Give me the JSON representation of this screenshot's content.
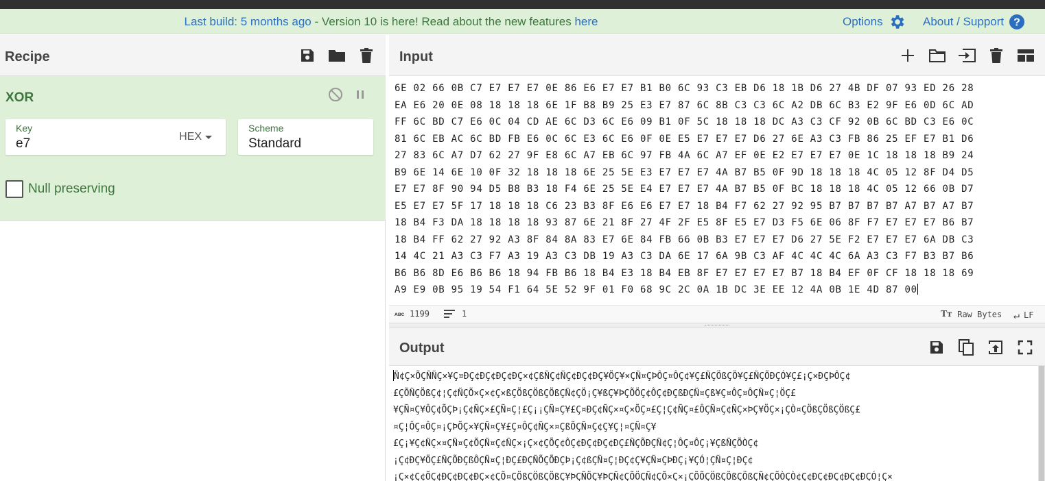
{
  "banner": {
    "last_build": "Last build: 5 months ago",
    "message": " - Version 10 is here! Read about the new features ",
    "link": "here",
    "options_label": "Options",
    "about_label": "About / Support"
  },
  "recipe": {
    "title": "Recipe",
    "operation": {
      "name": "XOR",
      "key_label": "Key",
      "key_value": "e7",
      "key_format": "HEX",
      "scheme_label": "Scheme",
      "scheme_value": "Standard",
      "null_preserving_label": "Null preserving"
    }
  },
  "input": {
    "title": "Input",
    "hex_lines": [
      "6E 02 66 0B C7 E7 E7 E7 0E 86 E6 E7 E7 B1 B0 6C 93 C3 EB D6 18 1B D6 27 4B DF 07 93 ED 26 28",
      "EA E6 20 0E 08 18 18 18 6E 1F B8 B9 25 E3 E7 87 6C 8B C3 C3 6C A2 DB 6C B3 E2 9F E6 0D 6C AD",
      "FF 6C BD C7 E6 0C 04 CD AE 6C D3 6C E6 09 B1 0F 5C 18 18 18 DC A3 C3 CF 92 0B 6C BD C3 E6 0C",
      "81 6C EB AC 6C BD FB E6 0C 6C E3 6C E6 0F 0E E5 E7 E7 E7 D6 27 6E A3 C3 FB 86 25 EF E7 B1 D6",
      "27 83 6C A7 D7 62 27 9F E8 6C A7 EB 6C 97 FB 4A 6C A7 EF 0E E2 E7 E7 E7 0E 1C 18 18 18 B9 24",
      "B9 6E 14 6E 10 0F 32 18 18 18 6E 25 5E E3 E7 E7 E7 4A B7 B5 0F 9D 18 18 18 4C 05 12 8F D4 D5",
      "E7 E7 8F 90 94 D5 B8 B3 18 F4 6E 25 5E E4 E7 E7 E7 4A B7 B5 0F BC 18 18 18 4C 05 12 66 0B D7",
      "E5 E7 E7 5F 17 18 18 18 C6 23 B3 8F E6 E6 E7 E7 18 B4 F7 62 27 92 95 B7 B7 B7 B7 A7 B7 A7 B7",
      "18 B4 F3 DA 18 18 18 18 93 87 6E 21 8F 27 4F 2F E5 8F E5 E7 D3 F5 6E 06 8F F7 E7 E7 E7 B6 B7",
      "18 B4 FF 62 27 92 A3 8F 84 8A 83 E7 6E 84 FB 66 0B B3 E7 E7 E7 D6 27 5E F2 E7 E7 E7 6A DB C3",
      "14 4C 21 A3 C3 F7 A3 19 A3 C3 DB 19 A3 C3 DA 6E 17 6A 9B C3 AF 4C 4C 4C 6A A3 C3 F7 B3 B7 B6",
      "B6 B6 8D E6 B6 B6 18 94 FB B6 18 B4 E3 18 B4 EB 8F E7 E7 E7 E7 B7 18 B4 EF 0F CF 18 18 18 69",
      "A9 E9 0B 95 19 54 F1 64 5E 52 9F 01 F0 68 9C 2C 0A 1B DC 3E EE 12 4A 0B 1E 4D 87 00"
    ],
    "length": "1199",
    "lines": "1",
    "encoding": "Raw Bytes",
    "eol": "LF"
  },
  "output": {
    "title": "Output",
    "lines": [
      "Ñ¢Ç×ÕÇÑÑÇ×¥Ç¤ÐÇ¢ÐÇ¢ÐÇ¢ÐÇ×¢ÇßÑÇ¢ÑÇ¢ÐÇ¢ÐÇ¥ÖÇ¥×ÇÑ¤ÇÞÔÇ¤ÔÇ¢¥Ç£ÑÇÖßÇÖ¥Ç£ÑÇÕÐÇÓ¥Ç£¡Ç×ÐÇÞÔÇ¢",
      "£ÇÕÑÇÖßÇ¢¦Ç¢ÑÇÕ×Ç×¢Ç×ßÇÖßÇÖßÇÖßÇÑ¢ÇÖ¡Ç¥ßÇ¥ÞÇÕÖÇ¢ÔÇ¢ÐÇßÐÇÑ¤Çß¥Ç¤ÔÇ¤ÔÇÑ¤Ç¦ÖÇ£",
      "¥ÇÑ¤Ç¥ÔÇ¢ÕÇÞ¡Ç¢ÑÇ×£ÇÑ¤Ç¦£Ç¡¡ÇÑ¤Ç¥£Ç¤ÐÇ¢ÑÇ×¤Ç×ÕÇ¤£Ç¦Ç¢ÑÇ¤£ÔÇÑ¤Ç¢ÑÇ×ÞÇ¥ÖÇ×¡ÇÒ¤ÇÖßÇÖßÇÖßÇ£",
      "¤Ç¦ÔÇ¤ÔÇ¤¡ÇÞÕÇ×¥ÇÑ¤Ç¥£Ç¤ÔÇ¢ÑÇ×¤ÇßÕÇÑ¤Ç¢Ç¥Ç¦¤ÇÑ¤Ç¥",
      "£Ç¡¥Ç¢ÑÇ×¤ÇÑ¤Ç¢ÕÇÑ¤Ç¢ÑÇ×¡Ç×¢ÇÕÇ¢ÔÇ¢ÐÇ¢ÐÇ¢ÐÇ£ÑÇÕÐÇÑ¢Ç¦ÔÇ¤ÔÇ¡¥ÇßÑÇÕÒÇ¢",
      "¡Ç¢ÐÇ¥ÖÇ£ÑÇÕÐÇßÔÇÑ¤Ç¦ÐÇ£ÐÇÑÕÇÕÐÇÞ¡Ç¢ßÇÑ¤Ç¦ÐÇ¢Ç¥ÇÑ¤ÇÞÐÇ¡¥ÇÓ¦ÇÑ¤Ç¦ÐÇ¢",
      "¡Ç×¢Ç¢ÕÇ¢ÐÇ¢ÐÇ¢ÐÇ×¢ÇÕ¤ÇÖßÇÖßÇÖßÇ¥ÞÇÑÖÇ¥ÞÇÑ¢ÇÕÖÇÑ¢ÇÕ×Ç×¡ÇÕÕÇÖßÇÖßÇÖßÇÑ¢ÇÕÒÇÒ¢Ç¢ÐÇ¢ÐÇ¢ÐÇ¢ÐÇÓ¦Ç×"
    ]
  }
}
